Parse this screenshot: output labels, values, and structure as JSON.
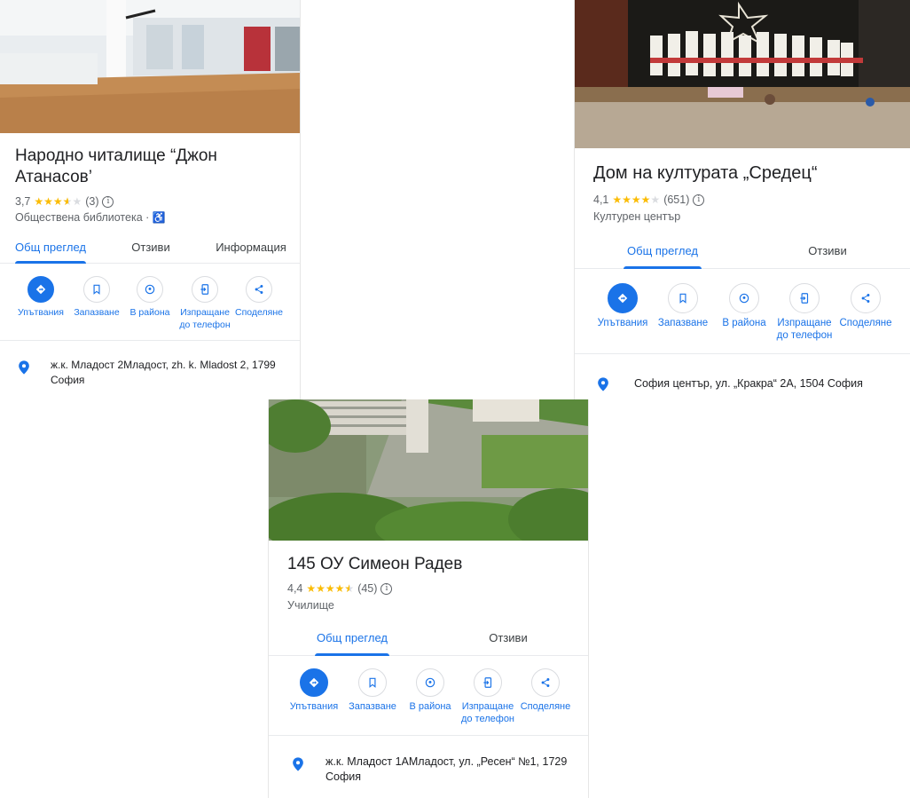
{
  "card1": {
    "title_line1": "Народно читалище “Джон",
    "title_line2": "Атанасов’",
    "rating": "3,7",
    "reviews": "(3)",
    "category": "Обществена библиотека",
    "category_sep": "·",
    "tabs": [
      "Общ преглед",
      "Отзиви",
      "Информация"
    ],
    "actions": [
      "Упътвания",
      "Запазване",
      "В района",
      "Изпращане",
      "до телефон",
      "Споделяне"
    ],
    "address_line1": "ж.к. Младост 2Младост, zh. k. Mladost 2, 1799",
    "address_line2": "София"
  },
  "card2": {
    "title": "Дом на културата „Средец“",
    "rating": "4,1",
    "reviews": "(651)",
    "category": "Културен център",
    "tabs": [
      "Общ преглед",
      "Отзиви"
    ],
    "actions": [
      "Упътвания",
      "Запазване",
      "В района",
      "Изпращане",
      "до телефон",
      "Споделяне"
    ],
    "address_line1": "София център, ул. „Кракра“ 2А, 1504 София"
  },
  "card3": {
    "title": "145 ОУ Симеон Радев",
    "rating": "4,4",
    "reviews": "(45)",
    "category": "Училище",
    "tabs": [
      "Общ преглед",
      "Отзиви"
    ],
    "actions": [
      "Упътвания",
      "Запазване",
      "В района",
      "Изпращане",
      "до телефон",
      "Споделяне"
    ],
    "address_line1": "ж.к. Младост 1АМладост, ул. „Ресен“ №1, 1729",
    "address_line2": "София"
  },
  "icons": [
    "directions-icon",
    "bookmark-icon",
    "nearby-icon",
    "send-to-phone-icon",
    "share-icon",
    "location-pin-icon",
    "info-icon",
    "wheelchair-icon"
  ],
  "colors": {
    "accent": "#1a73e8",
    "star": "#fbbc04",
    "text": "#202124",
    "secondary": "#5f6368"
  }
}
